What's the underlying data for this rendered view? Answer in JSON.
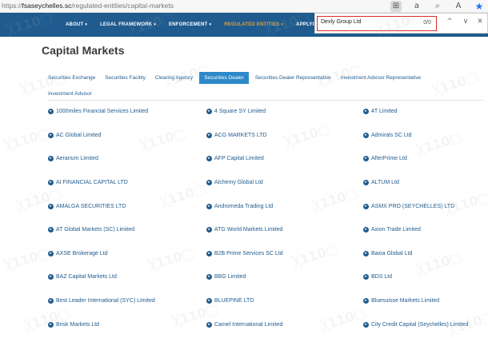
{
  "browser": {
    "url_prefix": "https://",
    "url_domain": "fsaseychelles.sc",
    "url_path": "/regulated-entities/capital-markets",
    "icons": [
      "translate-icon",
      "read-aloud-icon",
      "zoom-icon",
      "text-size-icon",
      "favorite-star-icon"
    ]
  },
  "nav": {
    "items": [
      {
        "label": "ABOUT",
        "caret": "▾"
      },
      {
        "label": "LEGAL FRAMEWORK",
        "caret": "▾"
      },
      {
        "label": "ENFORCEMENT",
        "caret": "▾"
      },
      {
        "label": "REGULATED ENTITIES",
        "caret": "▾"
      },
      {
        "label": "APPLYING FO"
      }
    ],
    "active_color": "#d8a248",
    "bg_color": "#1f5b8e"
  },
  "find": {
    "value": "Dexly Group Ltd",
    "count": "0/0",
    "prev": "^",
    "next": "∨",
    "close": "✕"
  },
  "page": {
    "title": "Capital Markets"
  },
  "tabs": [
    {
      "label": "Securities Exchange"
    },
    {
      "label": "Securities Facility"
    },
    {
      "label": "Clearing Agency"
    },
    {
      "label": "Securities Dealer",
      "active": true
    },
    {
      "label": "Securities Dealer Representative"
    },
    {
      "label": "Investment Advisor Representative"
    },
    {
      "label": "Investment Advisor"
    }
  ],
  "entities": [
    "1000miles Financial Services Limited",
    "4 Square SY Limited",
    "4T Limited",
    "AC Global Limited",
    "ACG MARKETS LTD",
    "Admirals SC Ltd",
    "Aerarium Limited",
    "AFP Capital Limited",
    "AfterPrime Ltd",
    "AI FINANCIAL CAPITAL LTD",
    "Alchemy Global Ltd",
    "ALTUM Ltd",
    "AMALGA SECURITIES LTD",
    "Andromeda Trading Ltd",
    "ASMX PRO (SEYCHELLES) LTD",
    "AT Global Markets (SC) Limited",
    "ATG World Markets Limited",
    "Axion Trade Limited",
    "AXSE Brokerage Ltd",
    "B2B Prime Services SC Ltd",
    "Baxia Global Ltd",
    "BAZ Capital Markets Ltd",
    "BBG Limited",
    "BDS Ltd",
    "Best Leader International (SYC) Limited",
    "BLUEPINE LTD",
    "Bluesuisse Markets Limited",
    "Brisk Markets Ltd",
    "Camel International Limited",
    "City Credit Capital (Seychelles) Limited"
  ],
  "colors": {
    "link": "#1f5b8e",
    "tab_active_bg": "#2d88c9",
    "find_highlight": "#d9302b"
  }
}
